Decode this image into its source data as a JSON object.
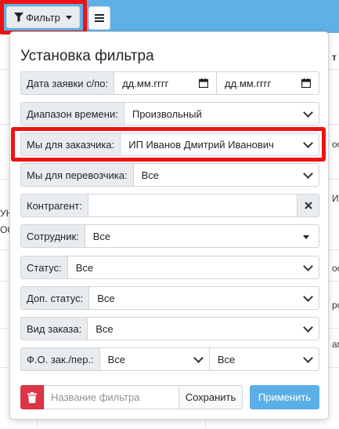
{
  "toolbar": {
    "filter_label": "Фильтр"
  },
  "background": {
    "header_fragment": "т",
    "fragments": [
      "ос",
      "Ин",
      "УН",
      "ОО",
      "рос",
      "ос",
      "ам"
    ]
  },
  "panel": {
    "title": "Установка фильтра",
    "date_label": "Дата заявки с/по:",
    "date_from_placeholder": "дд.мм.гггг",
    "date_to_placeholder": "дд.мм.гггг",
    "time_range_label": "Диапазон времени:",
    "time_range_value": "Произвольный",
    "customer_label": "Мы для заказчика:",
    "customer_value": "ИП Иванов Дмитрий Иванович",
    "carrier_label": "Мы для перевозчика:",
    "carrier_value": "Все",
    "counterparty_label": "Контрагент:",
    "counterparty_value": "",
    "employee_label": "Сотрудник:",
    "employee_value": "Все",
    "status_label": "Статус:",
    "status_value": "Все",
    "extra_status_label": "Доп. статус:",
    "extra_status_value": "Все",
    "order_type_label": "Вид заказа:",
    "order_type_value": "Все",
    "fo_label": "Ф.О. зак./пер.:",
    "fo_customer_value": "Все",
    "fo_carrier_value": "Все",
    "filter_name_placeholder": "Название фильтра",
    "save_label": "Сохранить",
    "apply_label": "Применить"
  },
  "colors": {
    "accent": "#5ab0e6",
    "danger": "#dc3545",
    "highlight": "#ee1313"
  }
}
